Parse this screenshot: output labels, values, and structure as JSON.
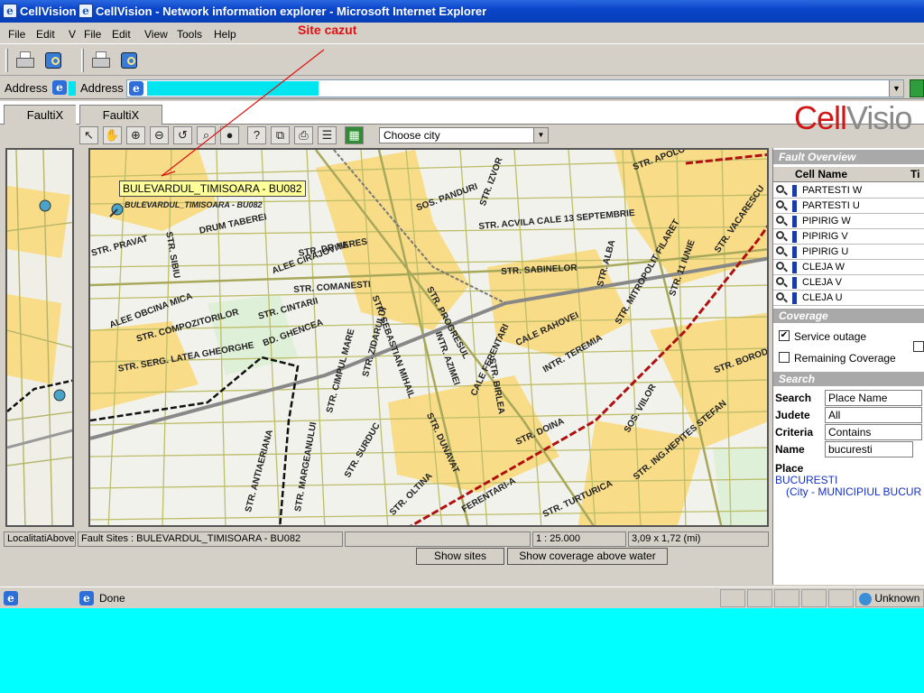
{
  "back_window": {
    "title": "CellVision",
    "menu": [
      "File",
      "Edit",
      "Vi"
    ],
    "address_label": "Address",
    "app_tab": "FaultiX",
    "status": "LocalitatiAboveG"
  },
  "window": {
    "title": "CellVision - Network information explorer - Microsoft Internet Explorer",
    "menu": [
      "File",
      "Edit",
      "View",
      "Tools",
      "Help"
    ],
    "address_label": "Address"
  },
  "app": {
    "tab": "FaultiX",
    "brand_part1": "Cell",
    "brand_part2": "Visio",
    "city_select": "Choose city"
  },
  "annotation": "Site cazut",
  "map": {
    "tooltip": "BULEVARDUL_TIMISOARA - BU082",
    "site_label": "BULEVARDUL_TIMISOARA - BU082",
    "streets": [
      "STR. DR HERES",
      "SOS. PANDURI",
      "STR. ACVILA CALE 13 SEPTEMBRIE",
      "STR. SABINELOR",
      "DRUM TABEREI",
      "ALEE CIRAJOVITA",
      "STR. COMANESTI",
      "ALEE OBCINA MICA",
      "STR. COMPOZITORILOR",
      "STR. CINTARII",
      "BD. GHENCEA",
      "STR. SERG. LATEA GHEORGHE",
      "STR. PROGRESUL",
      "CALE RAHOVEI",
      "INTR. TEREMIA",
      "STR. MITROPOLIT FILARET",
      "STR. 11 IUNIE",
      "STR. VACARESCU",
      "STR. SEBASTIAN MIHAIL",
      "CALE FERENTARI",
      "STR. DUNAVAT",
      "STR. DOINA",
      "SOS. VIILOR",
      "STR. ING.HEPITES STEFAN",
      "STR. CIMPUL MARE",
      "STR. SURDUC",
      "STR. OLTINA",
      "STR. ANTIAERIANA",
      "STR. MARGEANULUI",
      "STR. ZIDARULUI",
      "STR. SIBIU",
      "STR. APOLO",
      "STR. IZVOR",
      "STR. ALBA",
      "INTR. AZIMEI",
      "FERENTARI-A",
      "STR. TURTURICA",
      "STR. BIRLEA",
      "STR. BORODINO",
      "STR. PRAVAT"
    ]
  },
  "status": {
    "fault_sites": "Fault Sites : BULEVARDUL_TIMISOARA - BU082",
    "scale": "1 : 25.000",
    "coords": "3,09 x 1,72 (mi)"
  },
  "buttons": {
    "show_sites": "Show sites",
    "show_coverage": "Show coverage above water"
  },
  "panel": {
    "fault_overview": "Fault Overview",
    "col_cell_name": "Cell Name",
    "col_time": "Ti",
    "cells": [
      "PARTESTI W",
      "PARTESTI U",
      "PIPIRIG W",
      "PIPIRIG V",
      "PIPIRIG U",
      "CLEJA W",
      "CLEJA V",
      "CLEJA U"
    ],
    "coverage_head": "Coverage",
    "service_outage": "Service outage",
    "remaining_coverage": "Remaining Coverage",
    "search_head": "Search",
    "search_label": "Search",
    "search_value": "Place Name",
    "judete_label": "Judete",
    "judete_value": "All",
    "criteria_label": "Criteria",
    "criteria_value": "Contains",
    "name_label": "Name",
    "name_value": "bucuresti",
    "place_label": "Place",
    "place_result": "BUCURESTI",
    "place_detail": "(City - MUNICIPIUL BUCUR"
  },
  "taskbar": {
    "done": "Done",
    "zone": "Unknown"
  }
}
